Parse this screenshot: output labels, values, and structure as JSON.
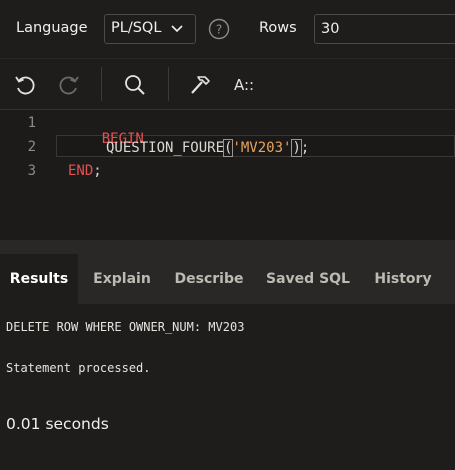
{
  "options": {
    "language_label": "Language",
    "language_value": "PL/SQL",
    "rows_label": "Rows",
    "rows_value": "30"
  },
  "toolbar": {
    "icons": [
      "undo-icon",
      "redo-icon",
      "search-icon",
      "hammer-icon",
      "format-icon"
    ],
    "format_label": "A::"
  },
  "editor": {
    "line_numbers": [
      "1",
      "2",
      "3"
    ],
    "line1_keyword": "BEGIN",
    "line2_proc": "QUESTION_FOURE",
    "line2_open": "(",
    "line2_string": "'MV203'",
    "line2_close": ")",
    "line2_end": ";",
    "line3_keyword": "END",
    "line3_end": ";"
  },
  "tabs": {
    "results": "Results",
    "explain": "Explain",
    "describe": "Describe",
    "saved_sql": "Saved SQL",
    "history": "History"
  },
  "results": {
    "output_line": "DELETE ROW WHERE OWNER_NUM: MV203",
    "status": "Statement processed.",
    "timing": "0.01 seconds"
  },
  "colors": {
    "background": "#1f1d1b",
    "keyword": "#e05252",
    "string": "#e7a55b"
  }
}
